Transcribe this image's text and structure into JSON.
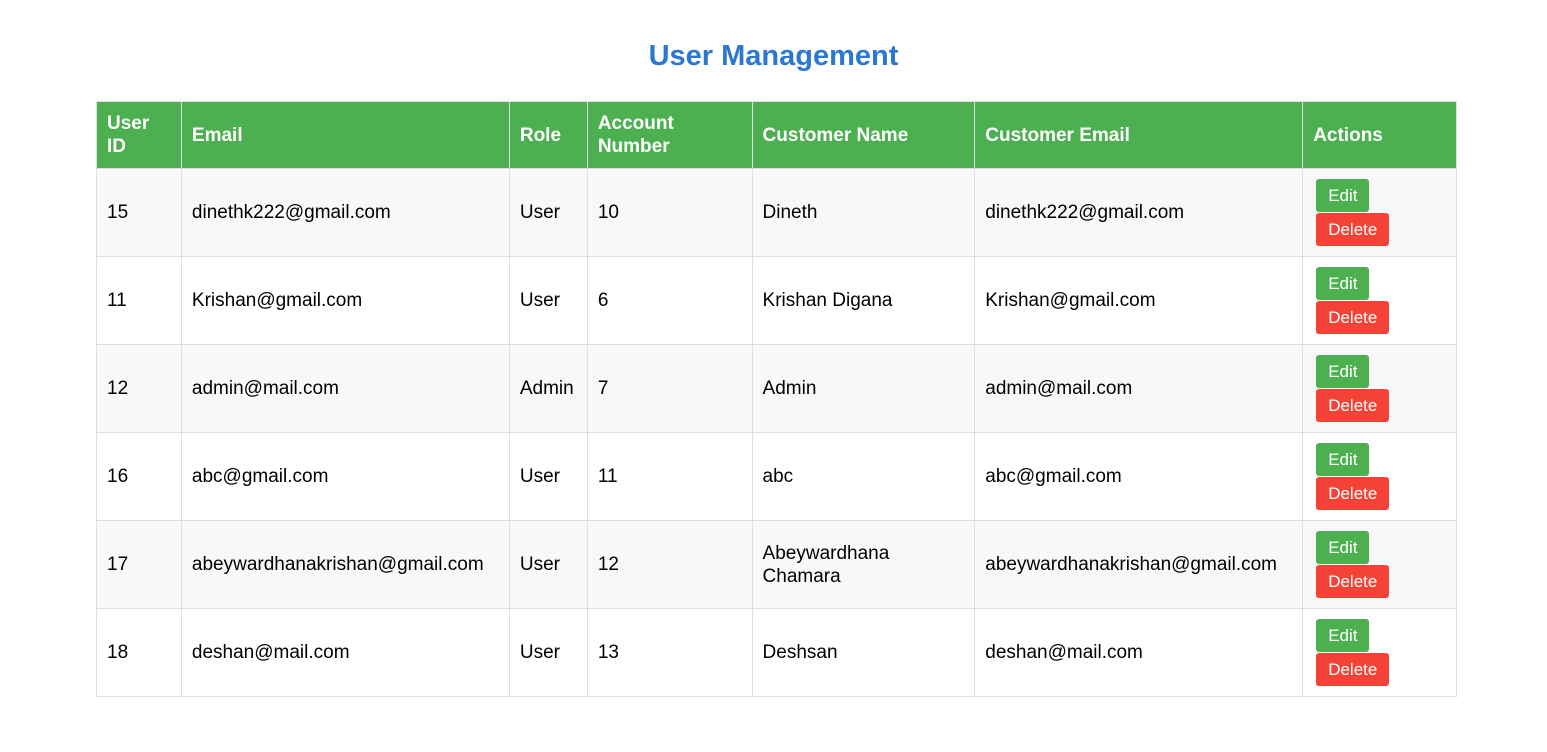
{
  "page": {
    "title": "User Management"
  },
  "table": {
    "headers": {
      "user_id": "User ID",
      "email": "Email",
      "role": "Role",
      "account_number": "Account Number",
      "customer_name": "Customer Name",
      "customer_email": "Customer Email",
      "actions": "Actions"
    },
    "edit_label": "Edit",
    "delete_label": "Delete",
    "rows": [
      {
        "user_id": "15",
        "email": "dinethk222@gmail.com",
        "role": "User",
        "account_number": "10",
        "customer_name": "Dineth",
        "customer_email": "dinethk222@gmail.com"
      },
      {
        "user_id": "11",
        "email": "Krishan@gmail.com",
        "role": "User",
        "account_number": "6",
        "customer_name": "Krishan Digana",
        "customer_email": "Krishan@gmail.com"
      },
      {
        "user_id": "12",
        "email": "admin@mail.com",
        "role": "Admin",
        "account_number": "7",
        "customer_name": "Admin",
        "customer_email": "admin@mail.com"
      },
      {
        "user_id": "16",
        "email": "abc@gmail.com",
        "role": "User",
        "account_number": "11",
        "customer_name": "abc",
        "customer_email": "abc@gmail.com"
      },
      {
        "user_id": "17",
        "email": "abeywardhanakrishan@gmail.com",
        "role": "User",
        "account_number": "12",
        "customer_name": "Abeywardhana Chamara",
        "customer_email": "abeywardhanakrishan@gmail.com"
      },
      {
        "user_id": "18",
        "email": "deshan@mail.com",
        "role": "User",
        "account_number": "13",
        "customer_name": "Deshsan",
        "customer_email": "deshan@mail.com"
      }
    ]
  },
  "colors": {
    "title": "#2a78cf",
    "header_bg": "#4caf50",
    "edit_button": "#4caf50",
    "delete_button": "#f44336",
    "row_alt_bg": "#f8f8f8"
  }
}
